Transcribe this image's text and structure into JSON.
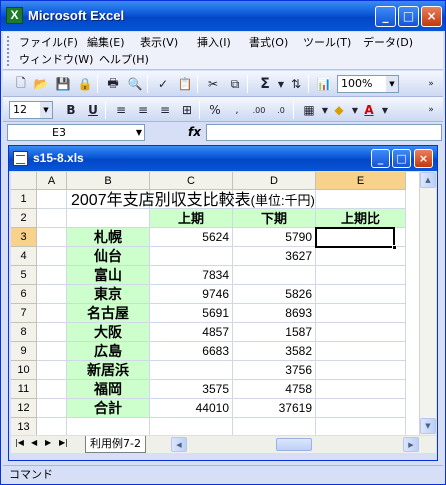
{
  "app": {
    "title": "Microsoft Excel"
  },
  "menu": [
    "ファイル(F)",
    "編集(E)",
    "表示(V)",
    "挿入(I)",
    "書式(O)",
    "ツール(T)",
    "データ(D)",
    "ウィンドウ(W)",
    "ヘルプ(H)"
  ],
  "toolbar": {
    "zoom": "100%",
    "font_size": "12"
  },
  "formula_bar": {
    "name_box": "E3",
    "fx": "fx",
    "value": ""
  },
  "workbook": {
    "title": "s15-8.xls",
    "sheet_tab": "利用例7-2"
  },
  "sheet": {
    "columns": [
      "A",
      "B",
      "C",
      "D",
      "E"
    ],
    "rows": [
      "1",
      "2",
      "3",
      "4",
      "5",
      "6",
      "7",
      "8",
      "9",
      "10",
      "11",
      "12",
      "13"
    ],
    "active_column": "E",
    "active_row": "3",
    "title": "2007年支店別収支比較表",
    "unit": "(単位:千円)",
    "headers": {
      "c": "上期",
      "d": "下期",
      "e": "上期比"
    },
    "data": [
      {
        "branch": "札幌",
        "first": "5624",
        "second": "5790",
        "ratio": ""
      },
      {
        "branch": "仙台",
        "first": "",
        "second": "3627",
        "ratio": ""
      },
      {
        "branch": "富山",
        "first": "7834",
        "second": "",
        "ratio": ""
      },
      {
        "branch": "東京",
        "first": "9746",
        "second": "5826",
        "ratio": ""
      },
      {
        "branch": "名古屋",
        "first": "5691",
        "second": "8693",
        "ratio": ""
      },
      {
        "branch": "大阪",
        "first": "4857",
        "second": "1587",
        "ratio": ""
      },
      {
        "branch": "広島",
        "first": "6683",
        "second": "3582",
        "ratio": ""
      },
      {
        "branch": "新居浜",
        "first": "",
        "second": "3756",
        "ratio": ""
      },
      {
        "branch": "福岡",
        "first": "3575",
        "second": "4758",
        "ratio": ""
      },
      {
        "branch": "合計",
        "first": "44010",
        "second": "37619",
        "ratio": ""
      }
    ]
  },
  "status": {
    "text": "コマンド"
  }
}
